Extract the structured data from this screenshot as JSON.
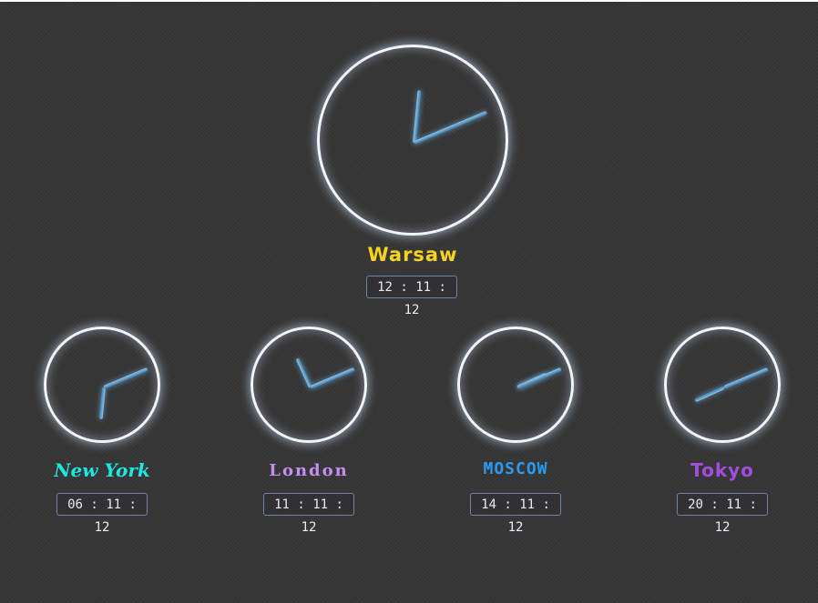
{
  "clocks": [
    {
      "city": "Warsaw",
      "time": "12 : 11 : 12",
      "hour": 12,
      "minute": 11,
      "second": 12,
      "color": "#f5d31e"
    },
    {
      "city": "New York",
      "time": "06 : 11 : 12",
      "hour": 6,
      "minute": 11,
      "second": 12,
      "color": "#1ee7e0"
    },
    {
      "city": "London",
      "time": "11 : 11 : 12",
      "hour": 11,
      "minute": 11,
      "second": 12,
      "color": "#c58ff0"
    },
    {
      "city": "MOSCOW",
      "time": "14 : 11 : 12",
      "hour": 14,
      "minute": 11,
      "second": 12,
      "color": "#2a9bf0"
    },
    {
      "city": "Tokyo",
      "time": "20 : 11 : 12",
      "hour": 20,
      "minute": 11,
      "second": 12,
      "color": "#a34de0"
    }
  ]
}
